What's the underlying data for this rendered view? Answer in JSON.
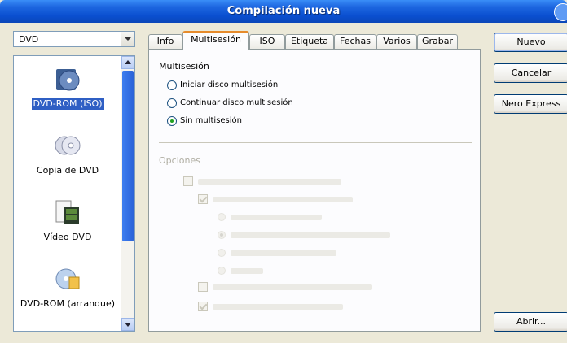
{
  "window": {
    "title": "Compilación nueva"
  },
  "left": {
    "combo_value": "DVD",
    "items": [
      {
        "label": "DVD-ROM (ISO)",
        "icon": "dvd-rom-iso-icon",
        "selected": true
      },
      {
        "label": "Copia de DVD",
        "icon": "dvd-copy-icon",
        "selected": false
      },
      {
        "label": "Vídeo DVD",
        "icon": "video-dvd-icon",
        "selected": false
      },
      {
        "label": "DVD-ROM (arranque)",
        "icon": "dvd-rom-boot-icon",
        "selected": false
      }
    ]
  },
  "tabs": [
    {
      "label": "Info"
    },
    {
      "label": "Multisesión",
      "active": true
    },
    {
      "label": "ISO"
    },
    {
      "label": "Etiqueta"
    },
    {
      "label": "Fechas"
    },
    {
      "label": "Varios"
    },
    {
      "label": "Grabar"
    }
  ],
  "multisession": {
    "title": "Multisesión",
    "options": [
      {
        "label": "Iniciar disco multisesión",
        "checked": false
      },
      {
        "label": "Continuar disco multisesión",
        "checked": false
      },
      {
        "label": "Sin multisesión",
        "checked": true
      }
    ]
  },
  "options": {
    "title": "Opciones"
  },
  "buttons": {
    "new": "Nuevo",
    "cancel": "Cancelar",
    "express": "Nero Express",
    "open": "Abrir..."
  },
  "colors": {
    "title_bar": "#0a4fd0",
    "selection": "#2f5fc4",
    "active_tab_accent": "#e68b2c"
  }
}
